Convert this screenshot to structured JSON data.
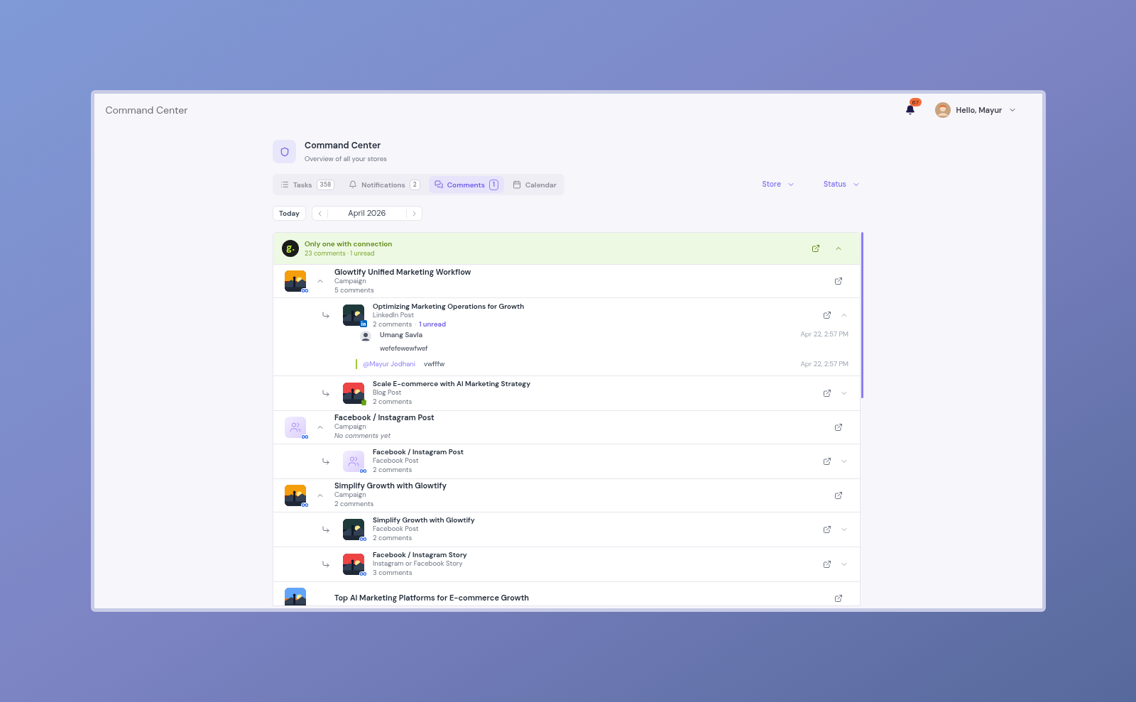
{
  "app_title": "Command Center",
  "user": {
    "greeting": "Hello, Mayur",
    "notifications": "67"
  },
  "header": {
    "title": "Command Center",
    "subtitle": "Overview of all your stores"
  },
  "tabs": [
    {
      "label": "Tasks",
      "count": "358",
      "selected": false
    },
    {
      "label": "Notifications",
      "count": "2",
      "selected": false
    },
    {
      "label": "Comments",
      "count": "1",
      "selected": true
    },
    {
      "label": "Calendar",
      "selected": false
    }
  ],
  "filters": [
    "Store",
    "Status"
  ],
  "date_nav": {
    "today": "Today",
    "month": "April 2026"
  },
  "group": {
    "logo": "g.",
    "name": "Only one with connection",
    "summary": "23 comments · 1 unread",
    "expanded": true
  },
  "items": [
    {
      "kind": "campaign",
      "title": "Glowtify Unified Marketing Workflow",
      "type": "Campaign",
      "comments": "5 comments",
      "empty": false,
      "badge": {
        "kind": "meta"
      },
      "expanded": true,
      "children": [
        {
          "kind": "post",
          "title": "Optimizing Marketing Operations for Growth",
          "type": "LinkedIn Post",
          "comments": "2 comments",
          "separator": "·",
          "unread": "1 unread",
          "badge": {
            "kind": "linkedin"
          },
          "expanded": true,
          "thread": [
            {
              "kind": "comment",
              "author": "Umang Savla",
              "text": "wefefewewfwef",
              "time": "Apr 22, 2:57 PM"
            },
            {
              "kind": "reply",
              "mention": "@Mayur Jodhani",
              "text": "vwfffw",
              "time": "Apr 22, 2:57 PM"
            }
          ]
        },
        {
          "kind": "post",
          "title": "Scale E-commerce with AI Marketing Strategy",
          "type": "Blog Post",
          "comments": "2 comments",
          "badge": {
            "kind": "shopify"
          },
          "expanded": false
        }
      ]
    },
    {
      "kind": "campaign",
      "title": "Facebook / Instagram Post",
      "type": "Campaign",
      "comments": "No comments yet",
      "empty": true,
      "thumb": {
        "kind": "placeholder"
      },
      "badge": {
        "kind": "meta"
      },
      "expanded": true,
      "children": [
        {
          "kind": "post",
          "title": "Facebook / Instagram Post",
          "type": "Facebook Post",
          "comments": "2 comments",
          "thumb": {
            "kind": "placeholder"
          },
          "badge": {
            "kind": "meta"
          },
          "expanded": false
        }
      ]
    },
    {
      "kind": "campaign",
      "title": "Simplify Growth with Glowtify",
      "type": "Campaign",
      "comments": "2 comments",
      "empty": false,
      "badge": {
        "kind": "meta"
      },
      "expanded": true,
      "children": [
        {
          "kind": "post",
          "title": "Simplify Growth with Glowtify",
          "type": "Facebook Post",
          "comments": "2 comments",
          "badge": {
            "kind": "meta"
          },
          "expanded": false
        },
        {
          "kind": "post",
          "title": "Facebook / Instagram Story",
          "type": "Instagram or Facebook Story",
          "comments": "3 comments",
          "badge": {
            "kind": "meta"
          },
          "expanded": false
        }
      ]
    },
    {
      "kind": "campaign",
      "title": "Top AI Marketing Platforms for E-commerce Growth"
    }
  ]
}
